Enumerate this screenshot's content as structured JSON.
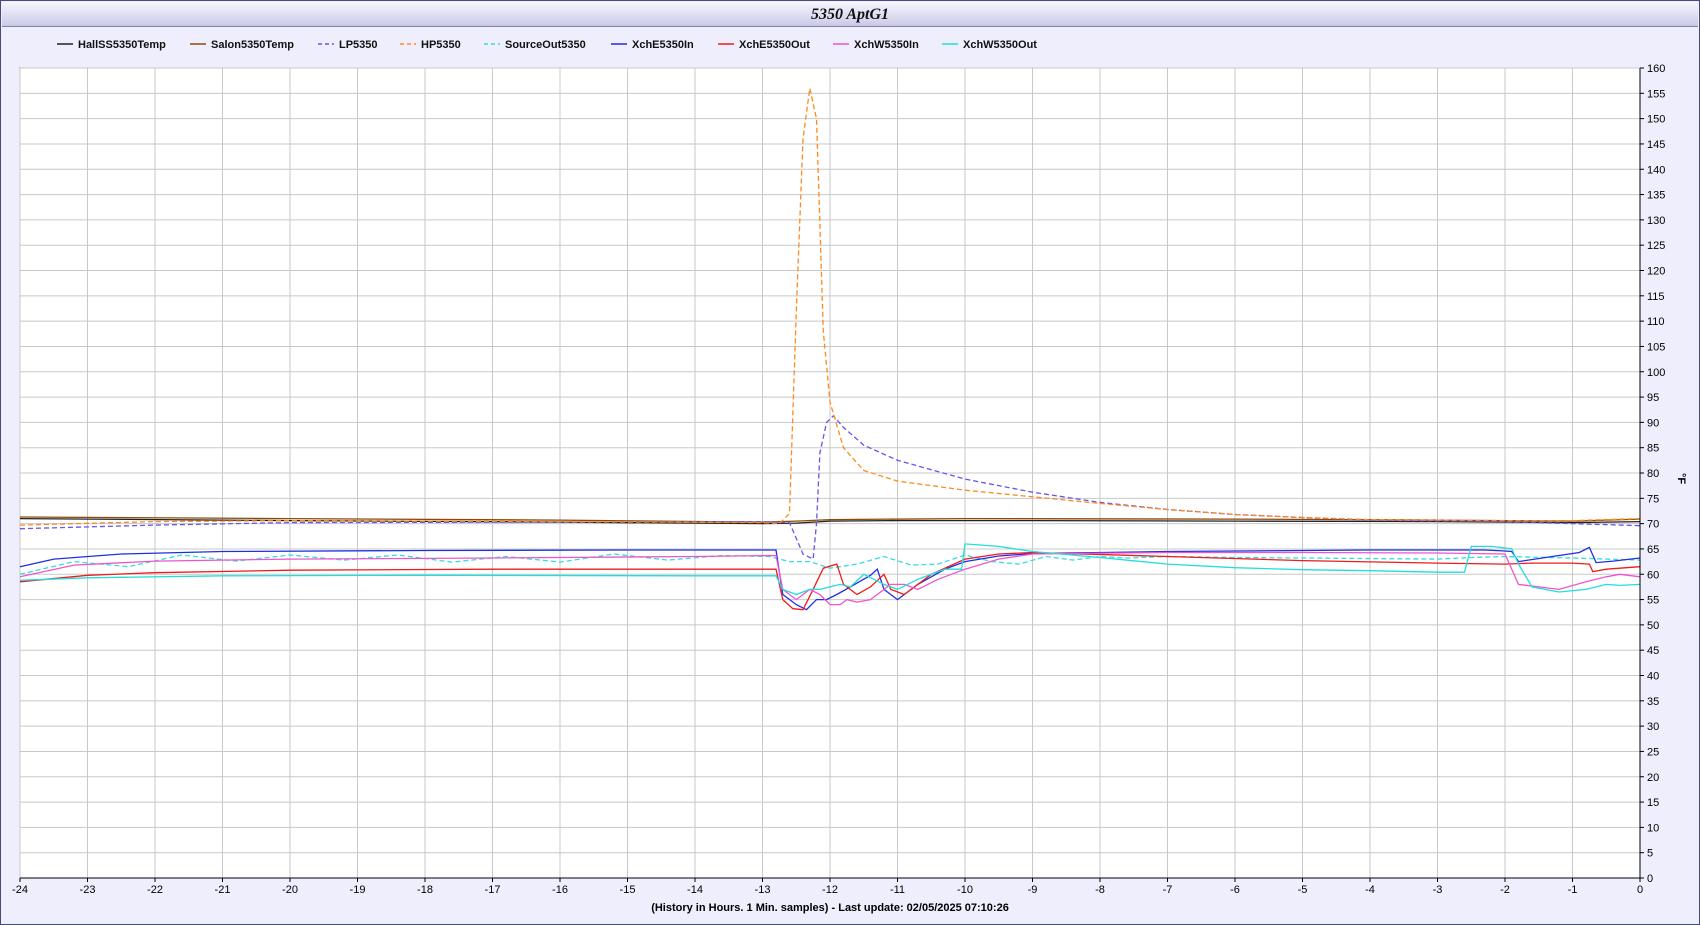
{
  "window": {
    "title": "5350 AptG1"
  },
  "chart_data": {
    "type": "line",
    "title": "5350 AptG1",
    "xlabel": "(History in Hours. 1 Min. samples) - Last update: 02/05/2025 07:10:26",
    "ylabel": "°F",
    "xlim": [
      -24,
      0
    ],
    "ylim": [
      0,
      160
    ],
    "x_ticks": [
      -24,
      -23,
      -22,
      -21,
      -20,
      -19,
      -18,
      -17,
      -16,
      -15,
      -14,
      -13,
      -12,
      -11,
      -10,
      -9,
      -8,
      -7,
      -6,
      -5,
      -4,
      -3,
      -2,
      -1,
      0
    ],
    "y_ticks": [
      0,
      5,
      10,
      15,
      20,
      25,
      30,
      35,
      40,
      45,
      50,
      55,
      60,
      65,
      70,
      75,
      80,
      85,
      90,
      95,
      100,
      105,
      110,
      115,
      120,
      125,
      130,
      135,
      140,
      145,
      150,
      155,
      160
    ],
    "grid": true,
    "legend_position": "top",
    "series": [
      {
        "name": "HallSS5350Temp",
        "color": "#222222",
        "dash": "solid",
        "points": [
          [
            -24,
            71
          ],
          [
            -20,
            70.6
          ],
          [
            -16,
            70.3
          ],
          [
            -13,
            70
          ],
          [
            -12.5,
            70.1
          ],
          [
            -12,
            70.5
          ],
          [
            -11,
            70.6
          ],
          [
            -9,
            70.6
          ],
          [
            -6,
            70.5
          ],
          [
            -3,
            70.4
          ],
          [
            -1,
            70.2
          ],
          [
            0,
            70.4
          ]
        ]
      },
      {
        "name": "Salon5350Temp",
        "color": "#8b4a0a",
        "dash": "solid",
        "points": [
          [
            -24,
            71.3
          ],
          [
            -20,
            71
          ],
          [
            -16,
            70.7
          ],
          [
            -13,
            70.3
          ],
          [
            -12.5,
            70.5
          ],
          [
            -12,
            70.8
          ],
          [
            -10,
            71
          ],
          [
            -6,
            70.9
          ],
          [
            -3,
            70.7
          ],
          [
            -1,
            70.5
          ],
          [
            0,
            70.9
          ]
        ]
      },
      {
        "name": "LP5350",
        "color": "#6655ee",
        "dash": "dashed",
        "points": [
          [
            -24,
            69
          ],
          [
            -22,
            69.7
          ],
          [
            -20,
            70.2
          ],
          [
            -16,
            70.3
          ],
          [
            -13,
            70.4
          ],
          [
            -12.6,
            70.2
          ],
          [
            -12.4,
            64
          ],
          [
            -12.25,
            63
          ],
          [
            -12.2,
            70
          ],
          [
            -12.15,
            84
          ],
          [
            -12.05,
            90
          ],
          [
            -11.95,
            91.3
          ],
          [
            -11.8,
            89
          ],
          [
            -11.5,
            85.5
          ],
          [
            -11,
            82.5
          ],
          [
            -10,
            78.8
          ],
          [
            -9,
            76.2
          ],
          [
            -8,
            74.2
          ],
          [
            -7,
            72.8
          ],
          [
            -6,
            71.8
          ],
          [
            -5,
            71.2
          ],
          [
            -4,
            70.7
          ],
          [
            -2,
            70.4
          ],
          [
            -1,
            70
          ],
          [
            0,
            69.6
          ]
        ]
      },
      {
        "name": "HP5350",
        "color": "#ff8a1a",
        "dash": "dashed",
        "points": [
          [
            -24,
            69.7
          ],
          [
            -22,
            70.4
          ],
          [
            -20,
            70.6
          ],
          [
            -16,
            70.4
          ],
          [
            -13,
            70.2
          ],
          [
            -12.75,
            70
          ],
          [
            -12.6,
            72
          ],
          [
            -12.5,
            112
          ],
          [
            -12.4,
            146
          ],
          [
            -12.3,
            156
          ],
          [
            -12.2,
            150
          ],
          [
            -12.1,
            108
          ],
          [
            -12,
            94
          ],
          [
            -11.8,
            85
          ],
          [
            -11.5,
            80.5
          ],
          [
            -11,
            78.4
          ],
          [
            -10,
            76.6
          ],
          [
            -9,
            75.3
          ],
          [
            -8,
            74
          ],
          [
            -7,
            72.8
          ],
          [
            -6,
            71.8
          ],
          [
            -5,
            71.2
          ],
          [
            -4,
            70.8
          ],
          [
            -2,
            70.6
          ],
          [
            -1,
            70.6
          ],
          [
            0,
            71
          ]
        ]
      },
      {
        "name": "SourceOut5350",
        "color": "#33dddd",
        "dash": "dashed",
        "points": [
          [
            -24,
            60
          ],
          [
            -23.2,
            62.5
          ],
          [
            -22.4,
            61.5
          ],
          [
            -21.6,
            63.8
          ],
          [
            -20.8,
            62.6
          ],
          [
            -20,
            63.8
          ],
          [
            -19.2,
            62.8
          ],
          [
            -18.4,
            63.8
          ],
          [
            -17.6,
            62.4
          ],
          [
            -16.8,
            63.5
          ],
          [
            -16,
            62.4
          ],
          [
            -15.2,
            64
          ],
          [
            -14.4,
            62.8
          ],
          [
            -13.6,
            63.7
          ],
          [
            -12.9,
            63.5
          ],
          [
            -12.6,
            62.5
          ],
          [
            -12.3,
            62.5
          ],
          [
            -12,
            61.2
          ],
          [
            -11.6,
            62
          ],
          [
            -11.2,
            63.5
          ],
          [
            -10.8,
            61.8
          ],
          [
            -10.4,
            62
          ],
          [
            -10,
            63.8
          ],
          [
            -9.6,
            62.5
          ],
          [
            -9.2,
            62
          ],
          [
            -8.8,
            63.5
          ],
          [
            -8.4,
            62.8
          ],
          [
            -8,
            63.5
          ],
          [
            -7.6,
            63.2
          ],
          [
            -7,
            63.5
          ],
          [
            -6,
            63.3
          ],
          [
            -5,
            63.2
          ],
          [
            -4,
            63.1
          ],
          [
            -3,
            63
          ],
          [
            -2.5,
            63.3
          ],
          [
            -2,
            63.5
          ],
          [
            -1,
            63.2
          ],
          [
            0,
            62.8
          ]
        ]
      },
      {
        "name": "XchE5350In",
        "color": "#1f2fe0",
        "dash": "solid",
        "points": [
          [
            -24,
            61.5
          ],
          [
            -23.5,
            63
          ],
          [
            -22.5,
            64
          ],
          [
            -21,
            64.5
          ],
          [
            -18,
            64.7
          ],
          [
            -15,
            64.8
          ],
          [
            -12.8,
            64.8
          ],
          [
            -12.7,
            56
          ],
          [
            -12.5,
            54
          ],
          [
            -12.35,
            53
          ],
          [
            -12.2,
            55
          ],
          [
            -12.05,
            55
          ],
          [
            -11.9,
            56
          ],
          [
            -11.7,
            57.5
          ],
          [
            -11.4,
            59.8
          ],
          [
            -11.3,
            61
          ],
          [
            -11.2,
            57
          ],
          [
            -11,
            55
          ],
          [
            -10.7,
            58
          ],
          [
            -10.3,
            61
          ],
          [
            -10,
            62.5
          ],
          [
            -9.5,
            63.6
          ],
          [
            -9,
            64.1
          ],
          [
            -7,
            64.5
          ],
          [
            -4,
            64.8
          ],
          [
            -2.3,
            64.8
          ],
          [
            -2,
            64.6
          ],
          [
            -1.9,
            64.5
          ],
          [
            -1.8,
            62.5
          ],
          [
            -1.3,
            63.5
          ],
          [
            -0.9,
            64.3
          ],
          [
            -0.75,
            65.3
          ],
          [
            -0.65,
            62.3
          ],
          [
            -0.4,
            62.6
          ],
          [
            0,
            63.2
          ]
        ]
      },
      {
        "name": "XchE5350Out",
        "color": "#ee1c1c",
        "dash": "solid",
        "points": [
          [
            -24,
            58.5
          ],
          [
            -23,
            59.8
          ],
          [
            -22,
            60.3
          ],
          [
            -20,
            60.8
          ],
          [
            -17,
            61
          ],
          [
            -14,
            61
          ],
          [
            -12.8,
            61
          ],
          [
            -12.7,
            55
          ],
          [
            -12.55,
            53.2
          ],
          [
            -12.4,
            53
          ],
          [
            -12.25,
            57
          ],
          [
            -12.1,
            61.2
          ],
          [
            -11.9,
            62
          ],
          [
            -11.8,
            58
          ],
          [
            -11.6,
            56
          ],
          [
            -11.4,
            57.5
          ],
          [
            -11.2,
            60
          ],
          [
            -11.1,
            57
          ],
          [
            -10.9,
            56
          ],
          [
            -10.5,
            60
          ],
          [
            -10,
            63
          ],
          [
            -9.5,
            64
          ],
          [
            -9,
            64.3
          ],
          [
            -7,
            63.5
          ],
          [
            -5,
            62.7
          ],
          [
            -3,
            62.2
          ],
          [
            -2,
            62
          ],
          [
            -1.6,
            62.2
          ],
          [
            -1,
            62.2
          ],
          [
            -0.75,
            62
          ],
          [
            -0.7,
            60.5
          ],
          [
            -0.5,
            61
          ],
          [
            0,
            61.5
          ]
        ]
      },
      {
        "name": "XchW5350In",
        "color": "#ee55cc",
        "dash": "solid",
        "points": [
          [
            -24,
            59.5
          ],
          [
            -23.2,
            61.8
          ],
          [
            -22,
            62.6
          ],
          [
            -20,
            63
          ],
          [
            -17,
            63.2
          ],
          [
            -14,
            63.5
          ],
          [
            -12.8,
            63.7
          ],
          [
            -12.7,
            57
          ],
          [
            -12.5,
            55
          ],
          [
            -12.3,
            57
          ],
          [
            -12.15,
            56
          ],
          [
            -12,
            54
          ],
          [
            -11.85,
            54
          ],
          [
            -11.75,
            55
          ],
          [
            -11.6,
            54.5
          ],
          [
            -11.4,
            55
          ],
          [
            -11.1,
            58
          ],
          [
            -10.9,
            58
          ],
          [
            -10.7,
            57
          ],
          [
            -10.4,
            59
          ],
          [
            -10,
            61
          ],
          [
            -9.5,
            63
          ],
          [
            -9,
            64
          ],
          [
            -7,
            64.3
          ],
          [
            -5,
            64.3
          ],
          [
            -3,
            64.2
          ],
          [
            -2,
            64
          ],
          [
            -1.8,
            58
          ],
          [
            -1.5,
            57.5
          ],
          [
            -1.2,
            57
          ],
          [
            -0.8,
            58.5
          ],
          [
            -0.5,
            59.5
          ],
          [
            -0.3,
            60
          ],
          [
            0,
            59.5
          ]
        ]
      },
      {
        "name": "XchW5350Out",
        "color": "#22dddd",
        "dash": "solid",
        "points": [
          [
            -24,
            58.8
          ],
          [
            -23,
            59.3
          ],
          [
            -21,
            59.7
          ],
          [
            -18,
            59.8
          ],
          [
            -14,
            59.7
          ],
          [
            -12.8,
            59.7
          ],
          [
            -12.7,
            57
          ],
          [
            -12.5,
            56
          ],
          [
            -12.3,
            57
          ],
          [
            -12.15,
            57
          ],
          [
            -12,
            57.5
          ],
          [
            -11.85,
            58
          ],
          [
            -11.7,
            57.5
          ],
          [
            -11.5,
            60
          ],
          [
            -11.2,
            58
          ],
          [
            -11,
            57
          ],
          [
            -10.7,
            59
          ],
          [
            -10.3,
            61
          ],
          [
            -10.05,
            61
          ],
          [
            -10,
            66
          ],
          [
            -9.5,
            65.5
          ],
          [
            -9,
            64.5
          ],
          [
            -8,
            63.3
          ],
          [
            -7,
            62
          ],
          [
            -6,
            61.3
          ],
          [
            -5,
            60.9
          ],
          [
            -4,
            60.7
          ],
          [
            -3,
            60.4
          ],
          [
            -2.6,
            60.4
          ],
          [
            -2.5,
            65.5
          ],
          [
            -2.2,
            65.5
          ],
          [
            -1.9,
            65
          ],
          [
            -1.8,
            62
          ],
          [
            -1.6,
            57.5
          ],
          [
            -1.2,
            56.5
          ],
          [
            -0.8,
            57
          ],
          [
            -0.5,
            58
          ],
          [
            -0.3,
            57.8
          ],
          [
            0,
            58
          ]
        ]
      }
    ]
  }
}
